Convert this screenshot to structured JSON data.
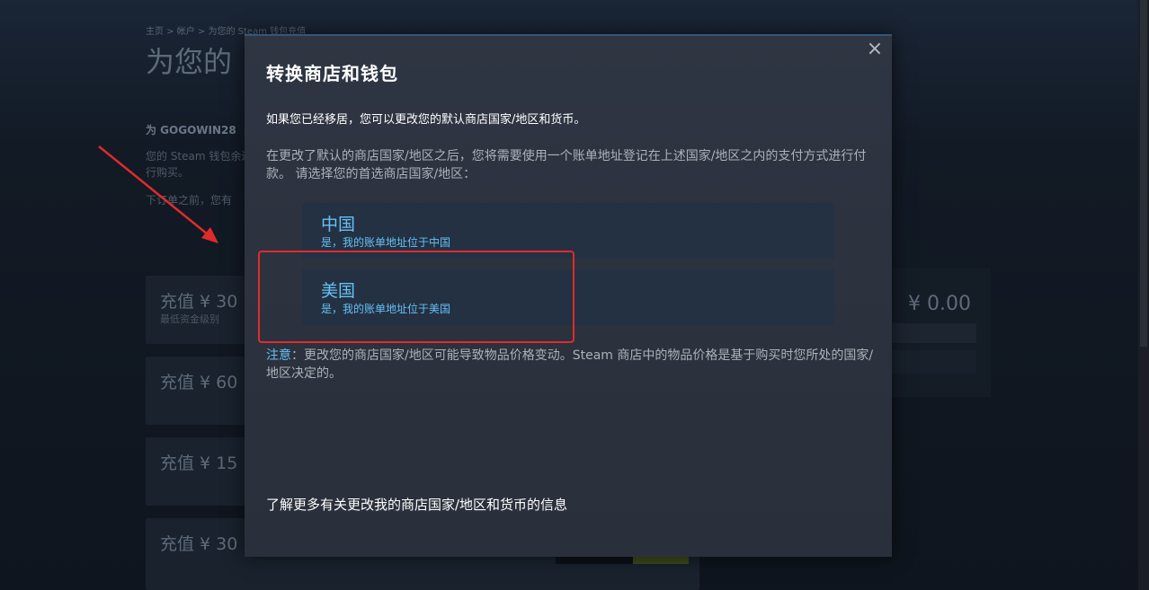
{
  "background": {
    "breadcrumb": "主页 > 帐户 > 为您的 Steam 钱包充值",
    "title_partial": "为您的",
    "for_user": "为 GOGOWIN28",
    "desc_line1": "您的 Steam 钱包余进行购买。",
    "desc_line2": "下订单之前，您有",
    "cards": [
      {
        "amount": "充值 ¥ 30",
        "sub": "最低资金级别"
      },
      {
        "amount": "充值 ¥ 60",
        "sub": ""
      },
      {
        "amount": "充值 ¥ 15",
        "sub": ""
      },
      {
        "amount": "充值 ¥ 30",
        "sub": ""
      }
    ],
    "total": "¥ 0.00"
  },
  "modal": {
    "title": "转换商店和钱包",
    "close_label": "×",
    "intro": "如果您已经移居，您可以更改您的默认商店国家/地区和货币。",
    "paragraph": "在更改了默认的商店国家/地区之后，您将需要使用一个账单地址登记在上述国家/地区之内的支付方式进行付款。 请选择您的首选商店国家/地区：",
    "countries": [
      {
        "name": "中国",
        "sub": "是，我的账单地址位于中国"
      },
      {
        "name": "美国",
        "sub": "是，我的账单地址位于美国"
      }
    ],
    "note_label": "注意",
    "note_text": "：更改您的商店国家/地区可能导致物品价格变动。Steam 商店中的物品价格是基于购买时您所处的国家/地区决定的。",
    "learn_more": "了解更多有关更改我的商店国家/地区和货币的信息"
  },
  "colors": {
    "accent_blue": "#66c0f4",
    "highlight_red": "#e02b2b",
    "modal_bg": "#2d333f"
  }
}
